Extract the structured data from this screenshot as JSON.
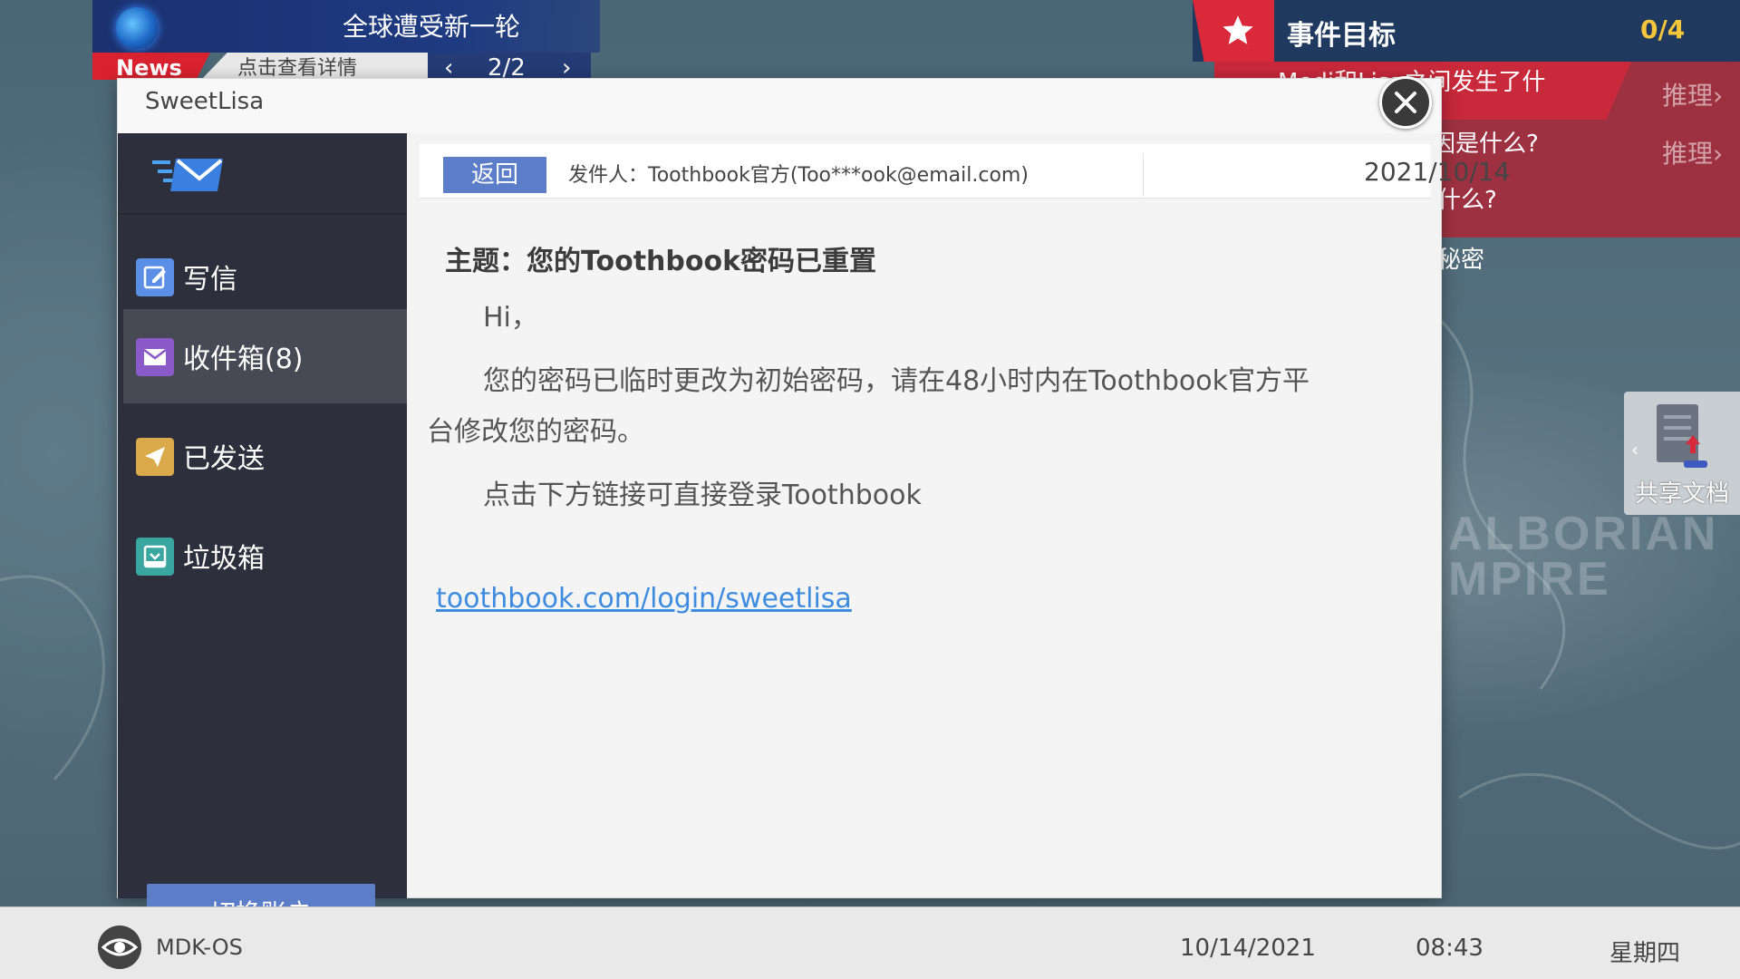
{
  "news": {
    "headline": "全球遭受新一轮",
    "tag": "News",
    "detail": "点击查看详情",
    "page": "2/2"
  },
  "event": {
    "title": "事件目标",
    "count": "0/4",
    "items": [
      "Medi和Lisa之间发生了什",
      "因是什么?",
      "什么?",
      "秘密"
    ],
    "infer_label": "推理"
  },
  "map": {
    "label_line1": "ALBORIAN",
    "label_line2": "MPIRE"
  },
  "share_doc": {
    "label": "共享文档"
  },
  "mail": {
    "window_title": "SweetLisa",
    "sidebar": {
      "items": [
        {
          "label": "写信"
        },
        {
          "label": "收件箱(8)"
        },
        {
          "label": "已发送"
        },
        {
          "label": "垃圾箱"
        }
      ],
      "switch_account": "切换账户"
    },
    "back": "返回",
    "sender": "发件人：Toothbook官方(Too***ook@email.com)",
    "date": "2021/10/14",
    "subject": "主题：您的Toothbook密码已重置",
    "greeting": "Hi，",
    "body_line1": "您的密码已临时更改为初始密码，请在48小时内在Toothbook官方平",
    "body_line2": "台修改您的密码。",
    "body_line3": "点击下方链接可直接登录Toothbook",
    "link": "toothbook.com/login/sweetlisa"
  },
  "taskbar": {
    "os_name": "MDK-OS",
    "date": "10/14/2021",
    "time": "08:43",
    "weekday": "星期四"
  },
  "colors": {
    "accent_blue": "#5c7dc8",
    "sidebar_bg": "#2d303c",
    "event_red": "#c8293b",
    "event_count": "#f5c53b",
    "link": "#3d8ce0"
  },
  "icons": {
    "compose": "compose-icon",
    "inbox": "envelope-icon",
    "sent": "paper-plane-icon",
    "trash": "trash-tray-icon",
    "close": "close-icon",
    "star": "star-icon",
    "globe": "globe-icon",
    "os": "eye-logo-icon",
    "share": "shared-document-icon"
  }
}
